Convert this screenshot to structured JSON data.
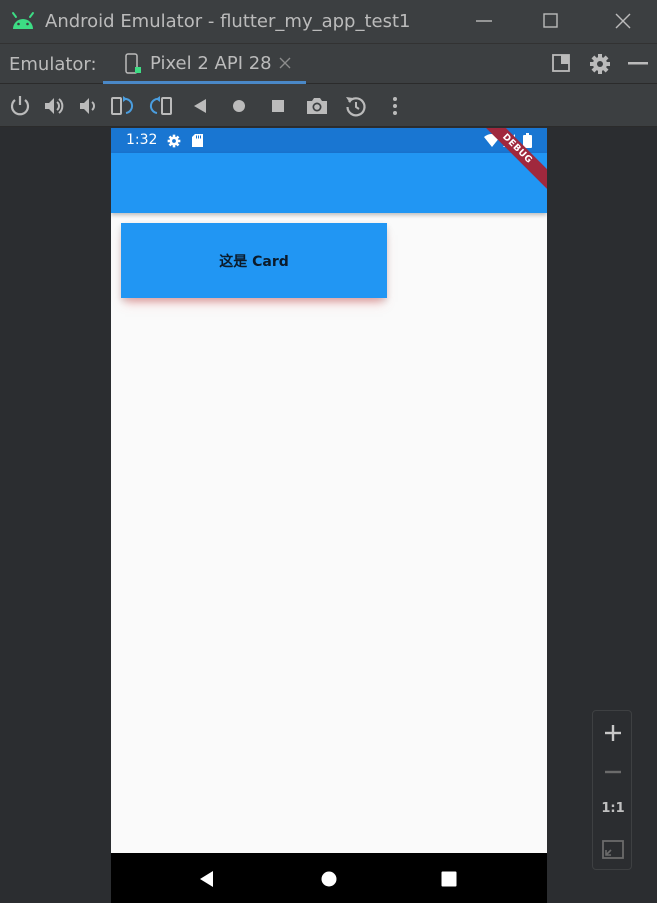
{
  "window": {
    "title": "Android Emulator - flutter_my_app_test1",
    "colors": {
      "titlebar": "#3c3f41",
      "background": "#2b2d30",
      "text": "#bbbbbb",
      "android_green": "#3ddc84"
    }
  },
  "tabbar": {
    "label": "Emulator:",
    "tab_label": "Pixel 2 API 28",
    "accent": "#4a88c7"
  },
  "toolbar": {
    "buttons": [
      "power-icon",
      "volume-up-icon",
      "volume-down-icon",
      "rotate-left-icon",
      "rotate-right-icon",
      "back-icon",
      "home-icon",
      "overview-icon",
      "screenshot-icon",
      "snapshot-icon",
      "more-icon"
    ]
  },
  "phone": {
    "status_time": "1:32",
    "debug_banner": "DEBUG",
    "card_text": "这是 Card",
    "colors": {
      "statusbar": "#1976d2",
      "appbar": "#2196f3",
      "card": "#2196f3",
      "banner": "#a0283d"
    }
  },
  "zoom": {
    "one_to_one": "1:1"
  }
}
